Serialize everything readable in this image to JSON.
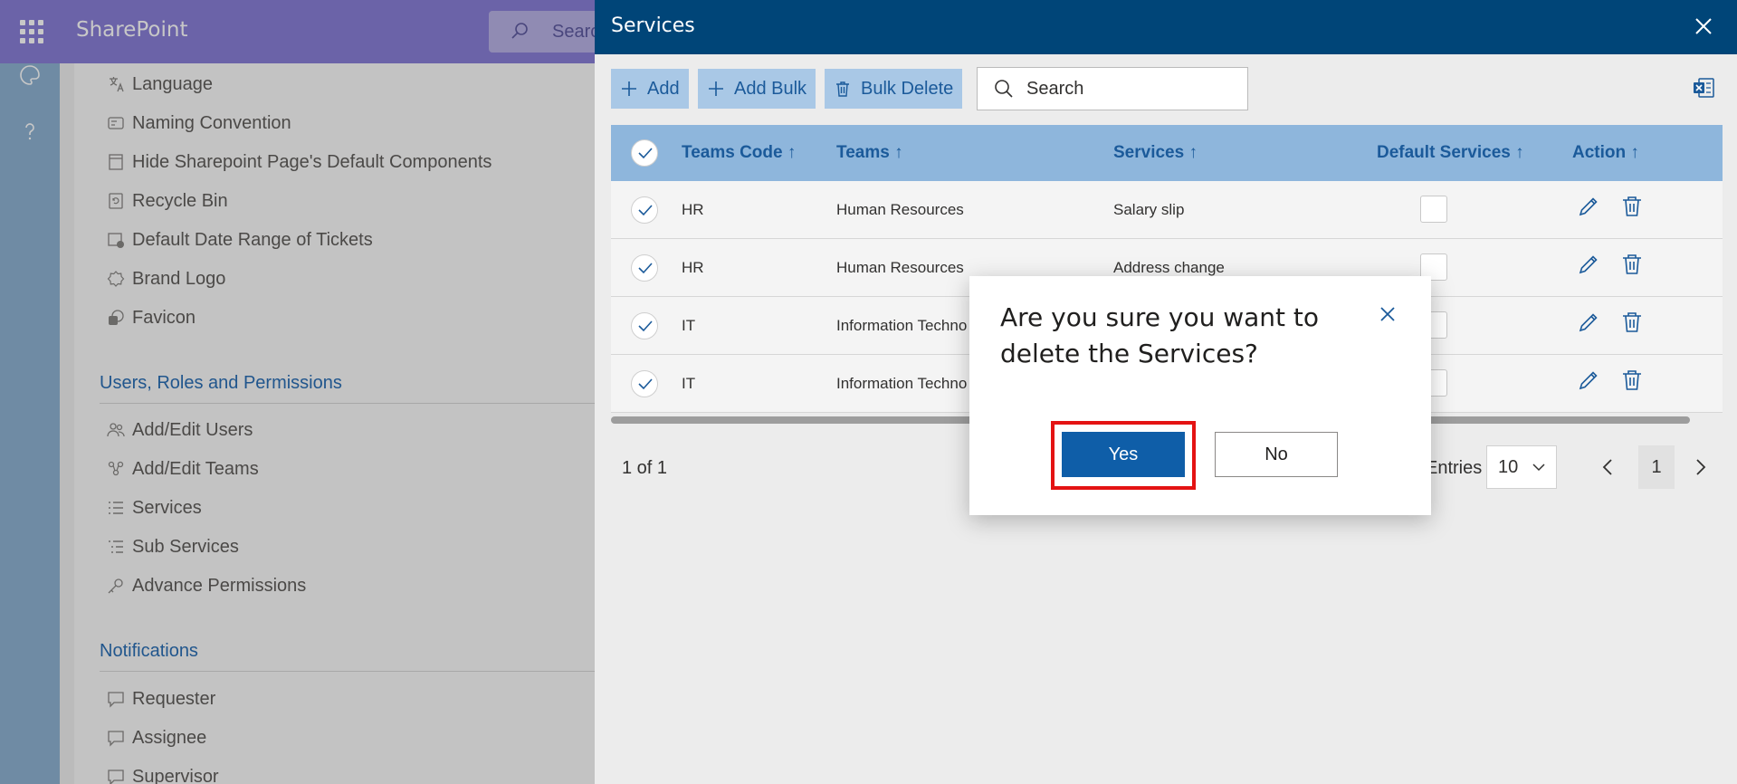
{
  "suite_bar": {
    "app_name": "SharePoint",
    "search_placeholder": "Search"
  },
  "settings": {
    "general_items": [
      {
        "label": "Language",
        "icon": "language-icon"
      },
      {
        "label": "Naming Convention",
        "icon": "naming-icon"
      },
      {
        "label": "Hide Sharepoint Page's Default Components",
        "icon": "page-icon"
      },
      {
        "label": "Recycle Bin",
        "icon": "recycle-bin-icon"
      },
      {
        "label": "Default Date Range of Tickets",
        "icon": "calendar-icon"
      },
      {
        "label": "Brand Logo",
        "icon": "brand-logo-icon"
      },
      {
        "label": "Favicon",
        "icon": "favicon-icon"
      }
    ],
    "users_section": {
      "title": "Users, Roles and Permissions",
      "items": [
        {
          "label": "Add/Edit Users",
          "icon": "users-icon"
        },
        {
          "label": "Add/Edit Teams",
          "icon": "teams-icon"
        },
        {
          "label": "Services",
          "icon": "list-icon"
        },
        {
          "label": "Sub Services",
          "icon": "sub-list-icon"
        },
        {
          "label": "Advance Permissions",
          "icon": "key-icon"
        }
      ]
    },
    "notifications_section": {
      "title": "Notifications",
      "items": [
        {
          "label": "Requester",
          "icon": "comment-icon"
        },
        {
          "label": "Assignee",
          "icon": "comment-icon"
        },
        {
          "label": "Supervisor",
          "icon": "comment-icon"
        }
      ]
    }
  },
  "panel": {
    "title": "Services",
    "toolbar": {
      "add_label": "Add",
      "add_bulk_label": "Add Bulk",
      "bulk_delete_label": "Bulk Delete",
      "search_placeholder": "Search"
    },
    "columns": [
      "Teams Code",
      "Teams",
      "Services",
      "Default Services",
      "Action"
    ],
    "sort_glyph": "↑",
    "rows": [
      {
        "code": "HR",
        "team": "Human Resources",
        "service": "Salary slip"
      },
      {
        "code": "HR",
        "team": "Human Resources",
        "service": "Address change"
      },
      {
        "code": "IT",
        "team": "Information Techno",
        "service": ""
      },
      {
        "code": "IT",
        "team": "Information Techno",
        "service": ""
      }
    ],
    "pager": {
      "status": "1 of 1",
      "entries_label": "Entries",
      "entries_value": "10",
      "current_page": "1"
    }
  },
  "dialog": {
    "message": "Are you sure you want to delete the Services?",
    "yes_label": "Yes",
    "no_label": "No"
  },
  "colors": {
    "suite_bar": "#8a7fd8",
    "panel_header": "#004578",
    "accent": "#0f5ea8",
    "highlight": "#e41313"
  }
}
